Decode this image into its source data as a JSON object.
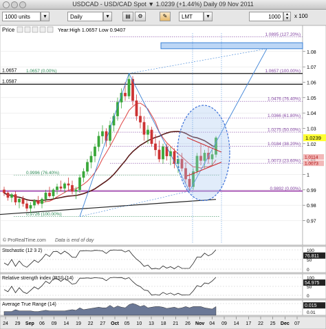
{
  "window": {
    "title": "USDCAD - USD/CAD Spot  ▼  1.0239 (+1.44%)  Daily  09 Nov 2011"
  },
  "toolbar": {
    "units_value": "1000 units",
    "period_value": "Daily",
    "order_type_value": "LMT",
    "quantity_value": "1000",
    "multiplier_label": "x 100"
  },
  "price_panel": {
    "name": "Price",
    "info": "Year:High 1.0657 Low 0.9407",
    "watermark": "© ProRealTime.com",
    "note": "Data is end of day",
    "current_price": "1.0239",
    "red_tags": [
      "1.0114",
      "1.0073"
    ]
  },
  "indicators": [
    {
      "key": "stochastic",
      "label": "Stochastic (12 3 2)",
      "value_tag": "76.811",
      "levels": [
        "100",
        "50",
        "0"
      ]
    },
    {
      "key": "rsi",
      "label": "Relative strength index (RSI) (14)",
      "value_tag": "54.975",
      "levels": [
        "100",
        "50",
        "0"
      ]
    },
    {
      "key": "atr",
      "label": "Average True Range (14)",
      "value_tag": "0.015",
      "levels": [
        "0.02",
        "0.01"
      ]
    }
  ],
  "colors": {
    "background": "#ffffff",
    "up_candle": "#3aa83a",
    "down_candle": "#cc3333",
    "ma_fast": "#e05050",
    "ma_slow": "#5a1a1a",
    "zigzag": "#3b82d6",
    "fib": "#8040a0",
    "ellipse": "#3a6fd8",
    "current_tag": "#ffff33"
  },
  "chart_data": {
    "type": "candlestick",
    "title": "USDCAD - USD/CAD Spot",
    "ylim": [
      0.955,
      1.092
    ],
    "y_ticks": [
      "1.08",
      "1.07",
      "1.06",
      "1.05",
      "1.04",
      "1.03",
      "1.02",
      "1.01",
      "1",
      "0.99",
      "0.98",
      "0.97"
    ],
    "x_ticks": [
      "24",
      "29",
      "Sep",
      "06",
      "09",
      "14",
      "19",
      "22",
      "27",
      "Oct",
      "05",
      "10",
      "13",
      "18",
      "21",
      "26",
      "Nov",
      "04",
      "09",
      "14",
      "17",
      "22",
      "25",
      "Dec",
      "07"
    ],
    "horizontal_levels": [
      {
        "label": "1.0657",
        "value": 1.0657
      },
      {
        "label": "1.0587",
        "value": 1.0587
      }
    ],
    "fib_levels": [
      {
        "label": "1.0895 (127.20%)",
        "value": 1.0895
      },
      {
        "label": "1.0657 (100.00%)",
        "value": 1.0657
      },
      {
        "label": "1.0476 (76.40%)",
        "value": 1.0476
      },
      {
        "label": "1.0366 (61.80%)",
        "value": 1.0366
      },
      {
        "label": "1.0275 (50.00%)",
        "value": 1.0275
      },
      {
        "label": "1.0184 (38.20%)",
        "value": 1.0184
      },
      {
        "label": "1.0073 (23.60%)",
        "value": 1.0073
      },
      {
        "label": "0.9892 (0.00%)",
        "value": 0.9892
      }
    ],
    "left_fib_labels": [
      {
        "label": "1.0657 (0.00%)",
        "value": 1.0657
      },
      {
        "label": "0.9996 (76.40%)",
        "value": 0.9996
      },
      {
        "label": "0.9726 (100.00%)",
        "value": 0.9726
      }
    ],
    "candles": [
      [
        0.99,
        0.992,
        0.986,
        0.988
      ],
      [
        0.988,
        0.989,
        0.983,
        0.985
      ],
      [
        0.985,
        0.988,
        0.982,
        0.987
      ],
      [
        0.987,
        0.989,
        0.98,
        0.982
      ],
      [
        0.982,
        0.985,
        0.978,
        0.984
      ],
      [
        0.984,
        0.986,
        0.979,
        0.981
      ],
      [
        0.981,
        0.983,
        0.976,
        0.978
      ],
      [
        0.978,
        0.982,
        0.975,
        0.98
      ],
      [
        0.98,
        0.984,
        0.978,
        0.983
      ],
      [
        0.983,
        0.986,
        0.98,
        0.981
      ],
      [
        0.981,
        0.985,
        0.978,
        0.984
      ],
      [
        0.984,
        0.99,
        0.982,
        0.988
      ],
      [
        0.988,
        0.992,
        0.985,
        0.986
      ],
      [
        0.986,
        0.991,
        0.984,
        0.99
      ],
      [
        0.99,
        0.994,
        0.987,
        0.992
      ],
      [
        0.992,
        0.996,
        0.989,
        0.991
      ],
      [
        0.991,
        0.995,
        0.988,
        0.994
      ],
      [
        0.994,
        0.998,
        0.99,
        0.993
      ],
      [
        0.993,
        0.996,
        0.987,
        0.989
      ],
      [
        0.989,
        0.992,
        0.984,
        0.99
      ],
      [
        0.99,
        1.0,
        0.988,
        0.998
      ],
      [
        0.998,
        1.004,
        0.995,
        1.002
      ],
      [
        1.002,
        1.01,
        1.0,
        1.008
      ],
      [
        1.008,
        1.015,
        1.004,
        1.012
      ],
      [
        1.012,
        1.02,
        1.008,
        1.018
      ],
      [
        1.018,
        1.028,
        1.015,
        1.025
      ],
      [
        1.025,
        1.032,
        1.02,
        1.028
      ],
      [
        1.028,
        1.03,
        1.018,
        1.022
      ],
      [
        1.022,
        1.035,
        1.019,
        1.032
      ],
      [
        1.032,
        1.04,
        1.028,
        1.038
      ],
      [
        1.038,
        1.05,
        1.035,
        1.047
      ],
      [
        1.047,
        1.056,
        1.043,
        1.053
      ],
      [
        1.053,
        1.06,
        1.048,
        1.051
      ],
      [
        1.051,
        1.066,
        1.049,
        1.062
      ],
      [
        1.062,
        1.064,
        1.045,
        1.048
      ],
      [
        1.048,
        1.052,
        1.035,
        1.038
      ],
      [
        1.038,
        1.044,
        1.03,
        1.034
      ],
      [
        1.034,
        1.038,
        1.022,
        1.026
      ],
      [
        1.026,
        1.032,
        1.02,
        1.029
      ],
      [
        1.029,
        1.031,
        1.018,
        1.02
      ],
      [
        1.02,
        1.026,
        1.012,
        1.016
      ],
      [
        1.016,
        1.022,
        1.008,
        1.01
      ],
      [
        1.01,
        1.02,
        1.007,
        1.018
      ],
      [
        1.018,
        1.02,
        1.009,
        1.012
      ],
      [
        1.012,
        1.018,
        1.006,
        1.015
      ],
      [
        1.015,
        1.017,
        1.004,
        1.007
      ],
      [
        1.007,
        1.012,
        1.001,
        1.01
      ],
      [
        1.01,
        1.014,
        1.002,
        1.004
      ],
      [
        1.004,
        1.008,
        0.994,
        0.997
      ],
      [
        0.997,
        1.001,
        0.989,
        0.992
      ],
      [
        0.992,
        1.004,
        0.99,
        1.002
      ],
      [
        1.002,
        1.014,
        1.0,
        1.012
      ],
      [
        1.012,
        1.02,
        1.006,
        1.009
      ],
      [
        1.009,
        1.016,
        1.004,
        1.014
      ],
      [
        1.014,
        1.018,
        1.007,
        1.01
      ],
      [
        1.01,
        1.016,
        1.006,
        1.013
      ],
      [
        1.013,
        1.025,
        1.011,
        1.0239
      ]
    ]
  }
}
